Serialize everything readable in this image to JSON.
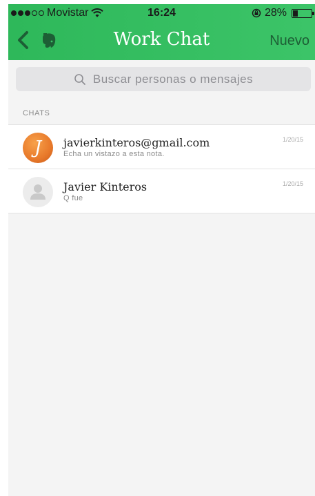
{
  "status_bar": {
    "carrier": "Movistar",
    "time": "16:24",
    "battery_text": "28%",
    "battery_level": 0.28
  },
  "nav": {
    "title": "Work Chat",
    "new_label": "Nuevo",
    "back_icon": "chevron-left-icon",
    "app_icon": "evernote-elephant-icon"
  },
  "search": {
    "placeholder": "Buscar personas o mensajes",
    "icon": "search-icon"
  },
  "section": {
    "label": "CHATS"
  },
  "chats": [
    {
      "name": "javierkinteros@gmail.com",
      "preview": "Echa un vistazo a esta nota.",
      "date": "1/20/15",
      "avatar_letter": "J"
    },
    {
      "name": "Javier Kinteros",
      "preview": "Q fue",
      "date": "1/20/15",
      "avatar_icon": "person-icon"
    }
  ],
  "colors": {
    "header_green": "#2eb85a",
    "nuevo_text": "#1d5e35"
  }
}
